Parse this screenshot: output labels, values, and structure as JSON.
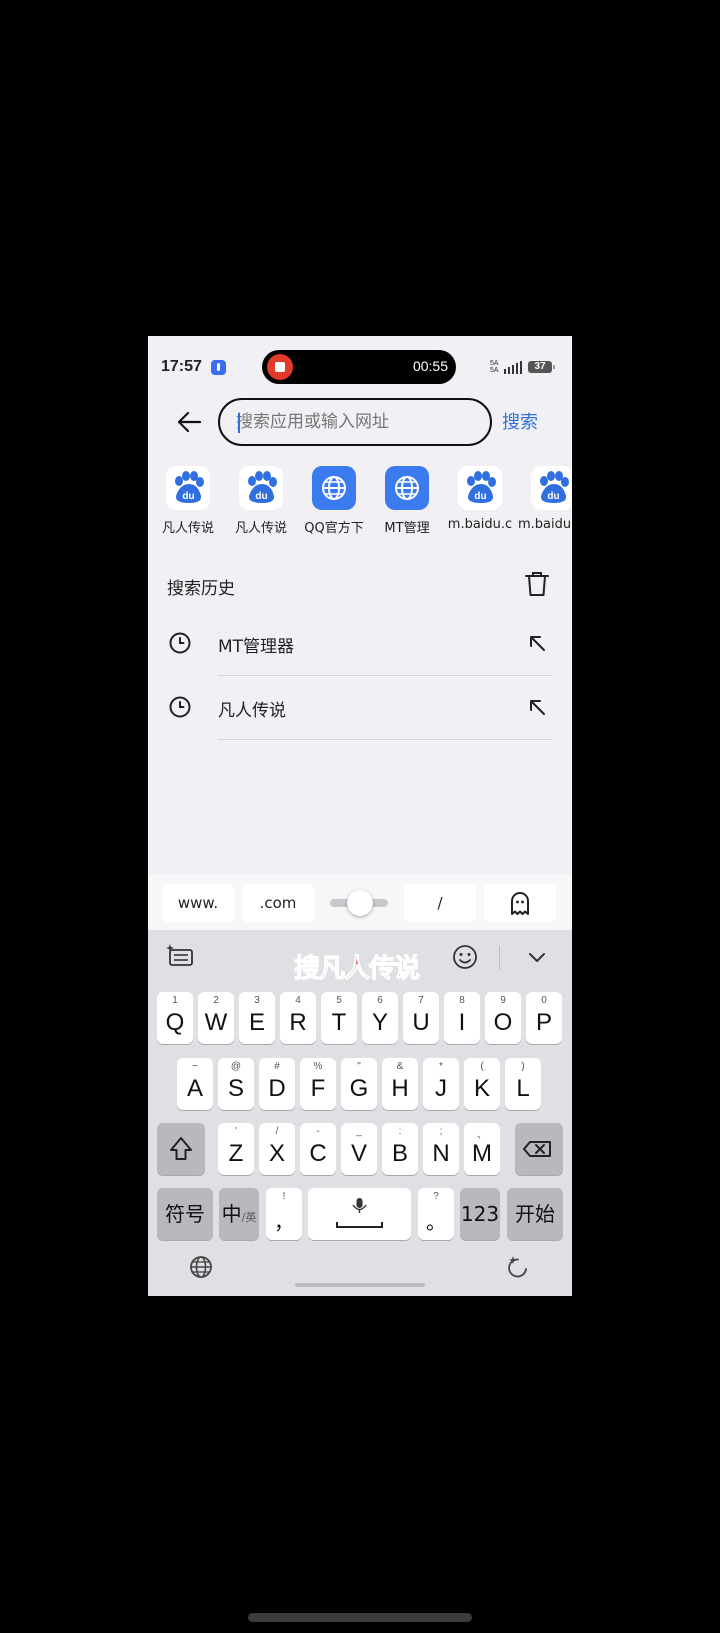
{
  "status": {
    "time": "17:57",
    "recording_time": "00:55",
    "sig1": "5A",
    "sig2": "5A",
    "battery": "37"
  },
  "search": {
    "placeholder": "搜索应用或输入网址",
    "button_label": "搜索"
  },
  "shortcuts": [
    {
      "label": "凡人传说",
      "icon": "baidu-paw-icon"
    },
    {
      "label": "凡人传说",
      "icon": "baidu-paw-icon"
    },
    {
      "label": "QQ官方下",
      "icon": "globe-icon"
    },
    {
      "label": "MT管理",
      "icon": "globe-icon"
    },
    {
      "label": "m.baidu.c",
      "icon": "baidu-paw-icon"
    },
    {
      "label": "m.baidu",
      "icon": "baidu-paw-icon"
    }
  ],
  "history": {
    "title": "搜索历史",
    "items": [
      {
        "text": "MT管理器"
      },
      {
        "text": "凡人传说"
      }
    ]
  },
  "quickbar": {
    "www": "www.",
    "com": ".com",
    "slash": "/"
  },
  "keyboard": {
    "overlay_text": "搜凡人传说",
    "row1": [
      {
        "hint": "1",
        "key": "Q"
      },
      {
        "hint": "2",
        "key": "W"
      },
      {
        "hint": "3",
        "key": "E"
      },
      {
        "hint": "4",
        "key": "R"
      },
      {
        "hint": "5",
        "key": "T"
      },
      {
        "hint": "6",
        "key": "Y"
      },
      {
        "hint": "7",
        "key": "U"
      },
      {
        "hint": "8",
        "key": "I"
      },
      {
        "hint": "9",
        "key": "O"
      },
      {
        "hint": "0",
        "key": "P"
      }
    ],
    "row2": [
      {
        "hint": "~",
        "key": "A"
      },
      {
        "hint": "@",
        "key": "S"
      },
      {
        "hint": "#",
        "key": "D"
      },
      {
        "hint": "%",
        "key": "F"
      },
      {
        "hint": "\"",
        "key": "G"
      },
      {
        "hint": "&",
        "key": "H"
      },
      {
        "hint": "*",
        "key": "J"
      },
      {
        "hint": "(",
        "key": "K"
      },
      {
        "hint": ")",
        "key": "L"
      }
    ],
    "row3": [
      {
        "hint": "'",
        "key": "Z"
      },
      {
        "hint": "/",
        "key": "X"
      },
      {
        "hint": "-",
        "key": "C"
      },
      {
        "hint": "_",
        "key": "V"
      },
      {
        "hint": ":",
        "key": "B"
      },
      {
        "hint": ";",
        "key": "N"
      },
      {
        "hint": "、",
        "key": "M"
      }
    ],
    "symbols": "符号",
    "lang_main": "中",
    "lang_sub": "/英",
    "comma_hint": "!",
    "comma": "，",
    "period_hint": "?",
    "period": "。",
    "num": "123",
    "go": "开始"
  },
  "colors": {
    "accent": "#2f6fdf",
    "overlay": "#e94b5b",
    "record": "#e23b2a"
  }
}
